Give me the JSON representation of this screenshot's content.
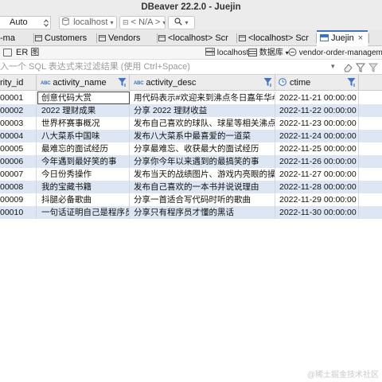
{
  "window": {
    "title": "DBeaver 22.2.0 - Juejin"
  },
  "toolbar": {
    "mode_select": "Auto",
    "datasource": "localhost",
    "schema": "< N/A >",
    "search_arrow": "▾"
  },
  "tabs": [
    {
      "label": "-ma"
    },
    {
      "label": "Customers"
    },
    {
      "label": "Vendors"
    },
    {
      "label": "<localhost> Scr"
    },
    {
      "label": "<localhost> Scr"
    },
    {
      "label": "Juejin",
      "active": true
    }
  ],
  "tab_close_glyph": "×",
  "subbar": {
    "er_label": "ER 图",
    "conn_localhost": "localhost",
    "conn_database": "数据库",
    "conn_table": "vendor-order-management"
  },
  "filter": {
    "placeholder": "入一个 SQL 表达式来过滤结果 (使用 Ctrl+Space)"
  },
  "columns": [
    {
      "label": "rity_id",
      "type_tag": ""
    },
    {
      "label": "activity_name",
      "type_tag": "ABC"
    },
    {
      "label": "activity_desc",
      "type_tag": "ABC"
    },
    {
      "label": "ctime",
      "type_tag": ""
    }
  ],
  "rows": [
    [
      "00001",
      "创意代码大赏",
      "用代码表示#欢迎来到沸点冬日嘉年华#",
      "2022-11-21 00:00:00"
    ],
    [
      "00002",
      "2022 理财成果",
      "分享 2022 理财收益",
      "2022-11-22 00:00:00"
    ],
    [
      "00003",
      "世界杯赛事概况",
      "发布自己喜欢的球队、球星等相关沸点",
      "2022-11-23 00:00:00"
    ],
    [
      "00004",
      "八大菜系中国味",
      "发布八大菜系中最喜爱的一道菜",
      "2022-11-24 00:00:00"
    ],
    [
      "00005",
      "最难忘的面试经历",
      "分享最难忘、收获最大的面试经历",
      "2022-11-25 00:00:00"
    ],
    [
      "00006",
      "今年遇到最好笑的事",
      "分享你今年以来遇到的最搞笑的事",
      "2022-11-26 00:00:00"
    ],
    [
      "00007",
      "今日份秀操作",
      "发布当天的战绩图片、游戏内亮眼的操作",
      "2022-11-27 00:00:00"
    ],
    [
      "00008",
      "我的宝藏书籍",
      "发布自己喜欢的一本书并说说理由",
      "2022-11-28 00:00:00"
    ],
    [
      "00009",
      "抖腿必备歌曲",
      "分享一首适合写代码时听的歌曲",
      "2022-11-29 00:00:00"
    ],
    [
      "00010",
      "一句话证明自己是程序员",
      "分享只有程序员才懂的黑话",
      "2022-11-30 00:00:00"
    ]
  ],
  "watermark": "@稀土掘金技术社区",
  "colors": {
    "row_alt": "#dde7f3",
    "header_bg": "#ececec",
    "accent": "#3c74c8"
  }
}
